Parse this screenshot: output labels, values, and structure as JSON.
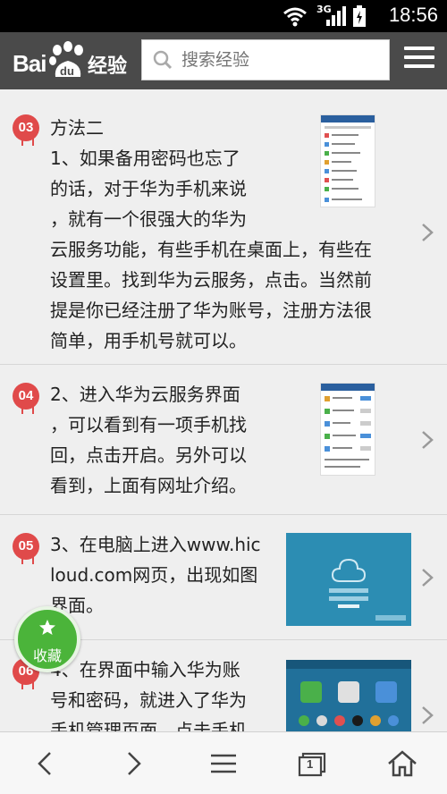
{
  "status_bar": {
    "time": "18:56",
    "network": "3G"
  },
  "header": {
    "logo_text_bai": "Bai",
    "logo_text_du": "du",
    "logo_text_jingyan": "经验",
    "search_placeholder": "搜索经验"
  },
  "steps": [
    {
      "number": "03",
      "lines": [
        "方法二",
        "1、如果备用密码也忘了",
        "的话，对于华为手机来说",
        "，就有一个很强大的华为",
        "云服务功能，有些手机在桌面上，有些在",
        "设置里。找到华为云服务，点击。当然前",
        "提是你已经注册了华为账号，注册方法很",
        "简单，用手机号就可以。"
      ]
    },
    {
      "number": "04",
      "lines": [
        "2、进入华为云服务界面",
        "，可以看到有一项手机找",
        "回，点击开启。另外可以",
        "看到，上面有网址介绍。"
      ]
    },
    {
      "number": "05",
      "lines": [
        "3、在电脑上进入www.hic",
        "loud.com网页，出现如图",
        "界面。"
      ]
    },
    {
      "number": "06",
      "lines": [
        "4、在界面中输入华为账",
        "号和密码，就进入了华为",
        "手机管理页面，点击手机"
      ]
    }
  ],
  "floating": {
    "favorite_label": "收藏"
  },
  "colors": {
    "header_bg": "#4a4a4a",
    "badge": "#e04a4a",
    "favorite": "#4bb43a"
  },
  "icons": [
    "wifi-icon",
    "signal-icon",
    "battery-icon",
    "search-icon",
    "menu-icon",
    "chevron-right-icon",
    "star-icon",
    "back-icon",
    "forward-icon",
    "menu-lines-icon",
    "tabs-icon",
    "home-icon"
  ],
  "nav": {
    "tabs_count": "1"
  }
}
